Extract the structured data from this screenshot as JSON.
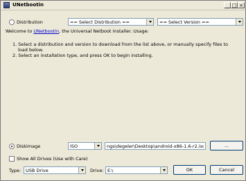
{
  "window": {
    "title": "UNetbootin",
    "min_glyph": "_",
    "max_glyph": "□",
    "close_glyph": "×"
  },
  "distribution": {
    "radio_label": "Distribution",
    "radio_selected": false,
    "select_distribution": "== Select Distribution ==",
    "select_version": "== Select Version =="
  },
  "info": {
    "welcome_prefix": "Welcome to ",
    "welcome_link": "UNetbootin",
    "welcome_suffix": ", the Universal Netboot Installer. Usage:",
    "step1_line1": "1. Select a distribution and version to download from the list above, or manually specify files to",
    "step1_line2": "load below.",
    "step2": "2. Select an installation type, and press OK to begin installing."
  },
  "diskimage": {
    "radio_label": "Diskimage",
    "radio_selected": true,
    "format_value": "ISO",
    "path_value": "ngs\\degeler\\Desktop\\android-x86-1.6-r2.iso",
    "browse_label": "..."
  },
  "options": {
    "show_all_drives_label": "Show All Drives (Use with Care)",
    "show_all_drives_checked": false
  },
  "target": {
    "type_label": "Type:",
    "type_value": "USB Drive",
    "drive_label": "Drive:",
    "drive_value": "E:\\",
    "ok_label": "OK",
    "cancel_label": "Cancel"
  }
}
